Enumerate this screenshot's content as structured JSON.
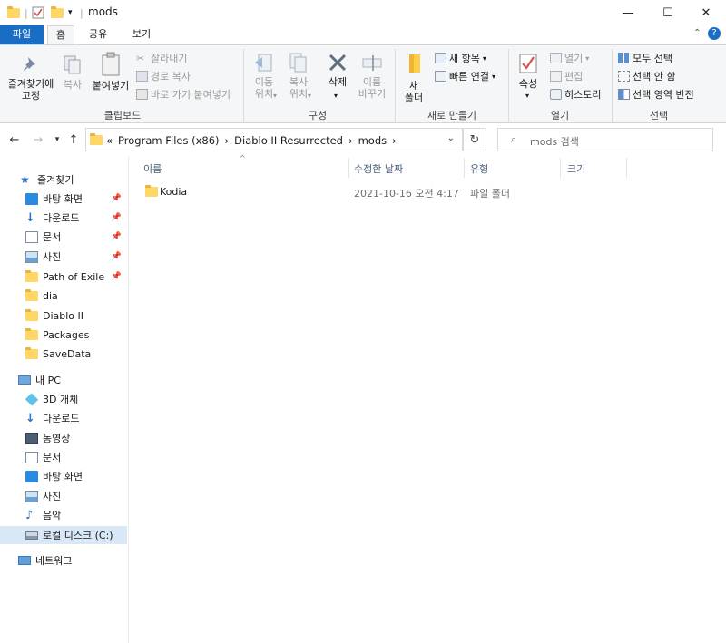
{
  "window": {
    "title": "mods",
    "minimize": "—",
    "maximize": "☐",
    "close": "✕"
  },
  "tabs": {
    "file": "파일",
    "home": "홈",
    "share": "공유",
    "view": "보기"
  },
  "ribbon": {
    "clipboard": {
      "pin_quick": "즐겨찾기에\n고정",
      "copy": "복사",
      "paste": "붙여넣기",
      "cut": "잘라내기",
      "copy_path": "경로 복사",
      "paste_shortcut": "바로 가기 붙여넣기",
      "label": "클립보드"
    },
    "organize": {
      "move_to": "이동\n위치",
      "copy_to": "복사\n위치",
      "delete": "삭제",
      "rename": "이름\n바꾸기",
      "label": "구성"
    },
    "new": {
      "new_folder": "새\n폴더",
      "new_item": "새 항목",
      "easy_access": "빠른 연결",
      "label": "새로 만들기"
    },
    "open": {
      "properties": "속성",
      "open": "열기",
      "edit": "편집",
      "history": "히스토리",
      "label": "열기"
    },
    "select": {
      "select_all": "모두 선택",
      "select_none": "선택 안 함",
      "invert": "선택 영역 반전",
      "label": "선택"
    }
  },
  "address": {
    "breadcrumb": [
      "«",
      "Program Files (x86)",
      "›",
      "Diablo II Resurrected",
      "›",
      "mods",
      "›"
    ],
    "search_placeholder": "mods 검색"
  },
  "nav": {
    "quick_access": "즐겨찾기",
    "items": [
      {
        "label": "바탕 화면",
        "icon": "desktop-icon",
        "pinned": true
      },
      {
        "label": "다운로드",
        "icon": "download-icon",
        "pinned": true
      },
      {
        "label": "문서",
        "icon": "document-icon",
        "pinned": true
      },
      {
        "label": "사진",
        "icon": "pictures-icon",
        "pinned": true
      },
      {
        "label": "Path of Exile",
        "icon": "folder-icon",
        "pinned": true
      },
      {
        "label": "dia",
        "icon": "folder-icon",
        "pinned": false
      },
      {
        "label": "Diablo II",
        "icon": "folder-icon",
        "pinned": false
      },
      {
        "label": "Packages",
        "icon": "folder-icon",
        "pinned": false
      },
      {
        "label": "SaveData",
        "icon": "folder-icon",
        "pinned": false
      }
    ],
    "this_pc": "내 PC",
    "pc_items": [
      {
        "label": "3D 개체",
        "icon": "3d-objects-icon"
      },
      {
        "label": "다운로드",
        "icon": "download-icon"
      },
      {
        "label": "동영상",
        "icon": "video-icon"
      },
      {
        "label": "문서",
        "icon": "document-icon"
      },
      {
        "label": "바탕 화면",
        "icon": "desktop-icon"
      },
      {
        "label": "사진",
        "icon": "pictures-icon"
      },
      {
        "label": "음악",
        "icon": "music-icon"
      },
      {
        "label": "로컬 디스크 (C:)",
        "icon": "drive-icon"
      }
    ],
    "network": "네트워크"
  },
  "columns": {
    "name": "이름",
    "modified": "수정한 날짜",
    "type": "유형",
    "size": "크기"
  },
  "files": [
    {
      "name": "Kodia",
      "modified": "2021-10-16 오전 4:17",
      "type": "파일 폴더",
      "size": ""
    }
  ],
  "colors": {
    "accent": "#1a6dc4",
    "folder": "#ffd766",
    "selection": "#d9e8f7"
  }
}
